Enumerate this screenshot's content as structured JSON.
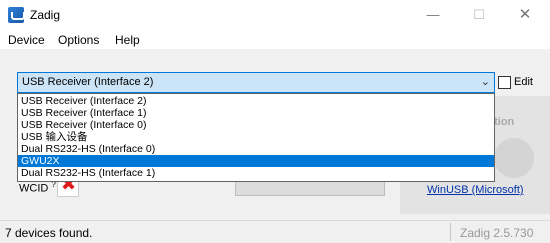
{
  "window": {
    "title": "Zadig"
  },
  "menu": {
    "device": "Device",
    "options": "Options",
    "help": "Help"
  },
  "combo": {
    "selected": "USB Receiver (Interface 2)"
  },
  "edit": {
    "label": "Edit",
    "checked": false
  },
  "dropdown": {
    "items": [
      "USB Receiver (Interface 2)",
      "USB Receiver (Interface 1)",
      "USB Receiver (Interface 0)",
      "USB 输入设备",
      "Dual RS232-HS (Interface 0)",
      "GWU2X",
      "Dual RS232-HS (Interface 1)"
    ],
    "highlighted": "GWU2X"
  },
  "wcid": {
    "label": "WCID"
  },
  "driver_link": "WinUSB (Microsoft)",
  "status": {
    "message": "7 devices found.",
    "version": "Zadig 2.5.730"
  },
  "colors": {
    "highlight": "#0078d7",
    "wcid_status": "#e0181c"
  }
}
